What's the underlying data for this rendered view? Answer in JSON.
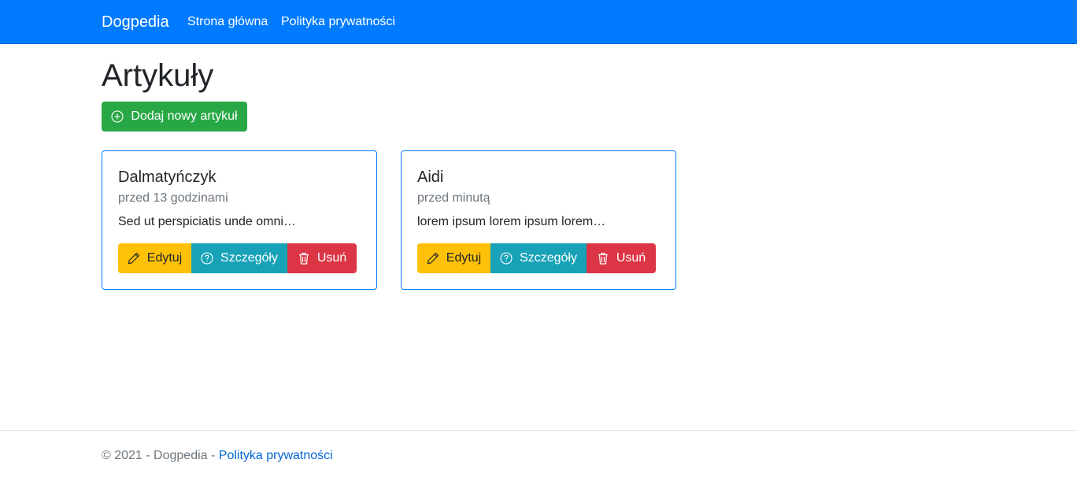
{
  "navbar": {
    "brand": "Dogpedia",
    "links": [
      "Strona główna",
      "Polityka prywatności"
    ],
    "bg_color": "#007bff"
  },
  "main": {
    "title": "Artykuły",
    "add_button_label": "Dodaj nowy artykuł",
    "add_button_icon": "plus-circle-icon",
    "articles": [
      {
        "title": "Dalmatyńczyk",
        "time": "przed 13 godzinami",
        "excerpt": "Sed ut perspiciatis unde omni…",
        "edit_label": "Edytuj",
        "details_label": "Szczegóły",
        "delete_label": "Usuń"
      },
      {
        "title": "Aidi",
        "time": "przed minutą",
        "excerpt": "lorem ipsum lorem ipsum lorem…",
        "edit_label": "Edytuj",
        "details_label": "Szczegóły",
        "delete_label": "Usuń"
      }
    ],
    "icons": {
      "edit": "pencil-icon",
      "details": "question-circle-icon",
      "delete": "trash-icon"
    }
  },
  "footer": {
    "copyright": "© 2021 - Dogpedia - ",
    "privacy_link": "Polityka prywatności"
  },
  "colors": {
    "success": "#28a745",
    "warning": "#ffc107",
    "info": "#17a2b8",
    "danger": "#dc3545",
    "link": "#0366d6"
  }
}
